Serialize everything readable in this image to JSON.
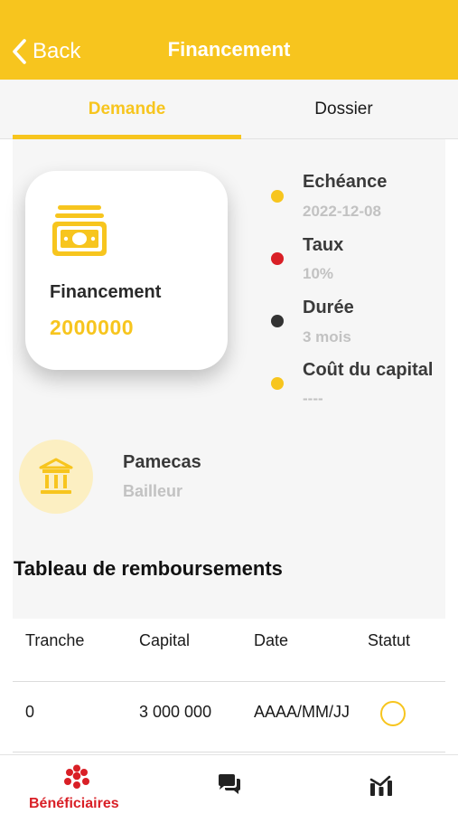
{
  "header": {
    "back_label": "Back",
    "title": "Financement"
  },
  "tabs": [
    {
      "label": "Demande",
      "active": true
    },
    {
      "label": "Dossier",
      "active": false
    }
  ],
  "financing": {
    "label": "Financement",
    "amount": "2000000",
    "icon": "cash-stack-icon"
  },
  "details": [
    {
      "label": "Echéance",
      "value": "2022-12-08",
      "dot_color": "#F7C51E"
    },
    {
      "label": "Taux",
      "value": "10%",
      "dot_color": "#D91F26"
    },
    {
      "label": "Durée",
      "value": "3 mois",
      "dot_color": "#333333"
    },
    {
      "label": "Coût du capital",
      "value": "----",
      "dot_color": "#F7C51E"
    }
  ],
  "lender": {
    "name": "Pamecas",
    "role": "Bailleur",
    "icon": "bank-icon"
  },
  "repayment": {
    "title": "Tableau de remboursements",
    "columns": [
      "Tranche",
      "Capital",
      "Date",
      "Statut"
    ],
    "rows": [
      {
        "tranche": "0",
        "capital": "3 000 000",
        "date": "AAAA/MM/JJ",
        "status": "pending"
      }
    ]
  },
  "bottom_nav": [
    {
      "label": "Bénéficiaires",
      "icon": "people-icon",
      "active": true
    },
    {
      "label": "",
      "icon": "chat-icon",
      "active": false
    },
    {
      "label": "",
      "icon": "stats-icon",
      "active": false
    }
  ],
  "colors": {
    "accent": "#F7C51E",
    "brand_red": "#D91F26",
    "muted": "#c2c2c2"
  }
}
